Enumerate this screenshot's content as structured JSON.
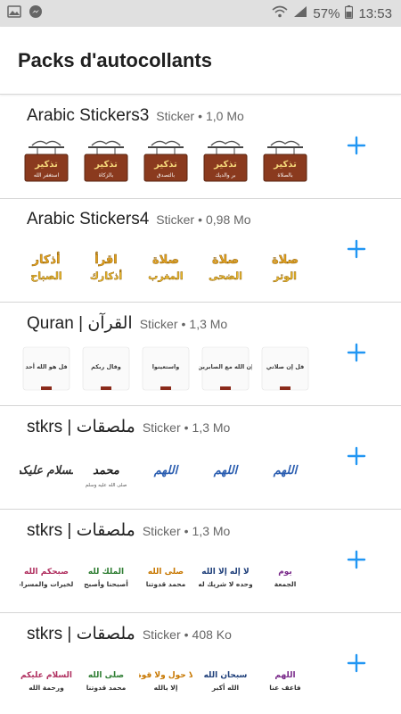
{
  "status_bar": {
    "battery": "57%",
    "time": "13:53"
  },
  "app_bar": {
    "title": "Packs d'autocollants"
  },
  "colors": {
    "accent": "#2196f3",
    "sign_wood": "#8a3a1e",
    "sign_text": "#f5d87a",
    "gold_text": "#e0a020",
    "blue_text": "#2a5db0"
  },
  "packs": [
    {
      "name": "Arabic Stickers3",
      "publisher": "Sticker",
      "separator": "•",
      "size": "1,0 Mo",
      "stickers": [
        {
          "text": "تذكير",
          "sub": "استغفر الله"
        },
        {
          "text": "تذكير",
          "sub": "بالزكاة"
        },
        {
          "text": "تذكير",
          "sub": "بالتصدق"
        },
        {
          "text": "تذكير",
          "sub": "بر والديك"
        },
        {
          "text": "تذكير",
          "sub": "بالصلاة"
        }
      ]
    },
    {
      "name": "Arabic Stickers4",
      "publisher": "Sticker",
      "separator": "•",
      "size": "0,98 Mo",
      "stickers": [
        {
          "text": "أذكار",
          "sub": "الصباح"
        },
        {
          "text": "اقرأ",
          "sub": "أذكارك"
        },
        {
          "text": "صلاة",
          "sub": "المغرب"
        },
        {
          "text": "صلاة",
          "sub": "الضحى"
        },
        {
          "text": "صلاة",
          "sub": "الوتر"
        }
      ]
    },
    {
      "name": "Quran | القرآن",
      "publisher": "Sticker",
      "separator": "•",
      "size": "1,3 Mo",
      "stickers": [
        {
          "text": "قل هو الله أحد",
          "sub": ""
        },
        {
          "text": "وقال ربكم",
          "sub": ""
        },
        {
          "text": "واستعينوا",
          "sub": ""
        },
        {
          "text": "إن الله مع الصابرين",
          "sub": ""
        },
        {
          "text": "قل إن صلاتي",
          "sub": ""
        }
      ]
    },
    {
      "name": "stkrs | ملصقات",
      "publisher": "Sticker",
      "separator": "•",
      "size": "1,3 Mo",
      "stickers": [
        {
          "text": "السلام عليكم",
          "sub": ""
        },
        {
          "text": "محمد",
          "sub": "صلى الله عليه وسلم"
        },
        {
          "text": "اللهم",
          "sub": ""
        },
        {
          "text": "اللهم",
          "sub": ""
        },
        {
          "text": "اللهم",
          "sub": ""
        }
      ]
    },
    {
      "name": "stkrs | ملصقات",
      "publisher": "Sticker",
      "separator": "•",
      "size": "1,3 Mo",
      "stickers": [
        {
          "text": "صبحكم الله",
          "sub": "بالخيرات والمسرات"
        },
        {
          "text": "الملك لله",
          "sub": "أصبحنا وأصبح"
        },
        {
          "text": "صلى الله",
          "sub": "محمد قدوتنا"
        },
        {
          "text": "لا إله إلا الله",
          "sub": "وحده لا شريك له"
        },
        {
          "text": "يوم",
          "sub": "الجمعة"
        }
      ]
    },
    {
      "name": "stkrs | ملصقات",
      "publisher": "Sticker",
      "separator": "•",
      "size": "408 Ko",
      "stickers": [
        {
          "text": "السلام عليكم",
          "sub": "ورحمة الله"
        },
        {
          "text": "صلى الله",
          "sub": "محمد قدوتنا"
        },
        {
          "text": "لا حول ولا قوة",
          "sub": "إلا بالله"
        },
        {
          "text": "سبحان الله",
          "sub": "الله أكبر"
        },
        {
          "text": "اللهم",
          "sub": "فاعف عنا"
        }
      ]
    }
  ]
}
